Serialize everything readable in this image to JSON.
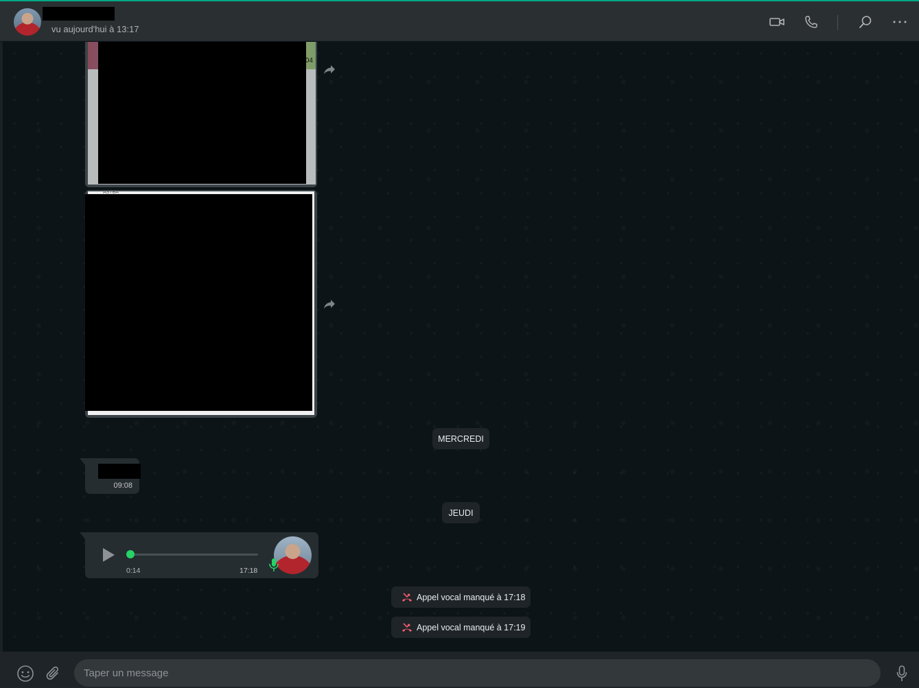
{
  "header": {
    "last_seen": "vu aujourd'hui à 13:17",
    "icons": [
      "video-call-icon",
      "voice-call-icon",
      "search-icon",
      "menu-icon"
    ]
  },
  "media": {
    "image1_tag": "04",
    "image2_caption": "ASTBA"
  },
  "dates": {
    "wednesday": "MERCREDI",
    "thursday": "JEUDI"
  },
  "messages": {
    "text_time": "09:08",
    "voice": {
      "duration": "0:14",
      "time": "17:18",
      "progress": 0
    }
  },
  "calls": [
    {
      "label": "Appel vocal manqué à 17:18"
    },
    {
      "label": "Appel vocal manqué à 17:19"
    }
  ],
  "composer": {
    "placeholder": "Taper un message"
  },
  "colors": {
    "accent": "#00a884",
    "voice_progress": "#25d366",
    "missed_call": "#f15c6d"
  }
}
